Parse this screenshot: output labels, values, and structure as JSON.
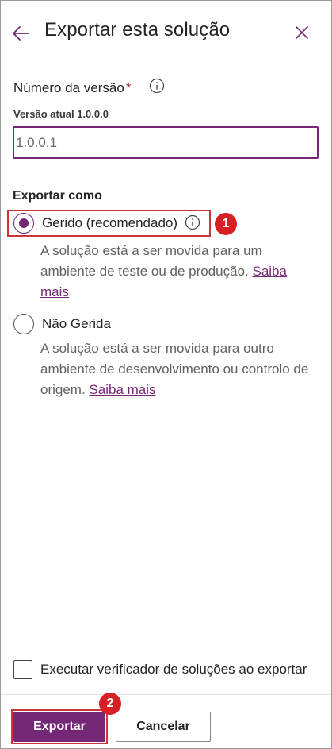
{
  "panel": {
    "title": "Exportar esta solução",
    "back_icon": "arrow-left-icon",
    "close_icon": "close-icon"
  },
  "version": {
    "label": "Número da versão",
    "required_mark": "*",
    "current": "Versão atual 1.0.0.0",
    "value": "1.0.0.1"
  },
  "export_as": {
    "heading": "Exportar como",
    "options": [
      {
        "label": "Gerido (recomendado)",
        "selected": true,
        "description": "A solução está a ser movida para um ambiente de teste ou de produção.",
        "link": "Saiba mais"
      },
      {
        "label": "Não Gerida",
        "selected": false,
        "description": "A solução está a ser movida para outro ambiente de desenvolvimento ou controlo de origem.",
        "link": "Saiba mais"
      }
    ]
  },
  "checker": {
    "label": "Executar verificador de soluções ao exportar",
    "checked": false
  },
  "footer": {
    "export_label": "Exportar",
    "cancel_label": "Cancelar"
  },
  "callouts": [
    "1",
    "2"
  ],
  "colors": {
    "accent": "#742774",
    "callout": "#d81f26",
    "highlight_border": "#d13438"
  }
}
